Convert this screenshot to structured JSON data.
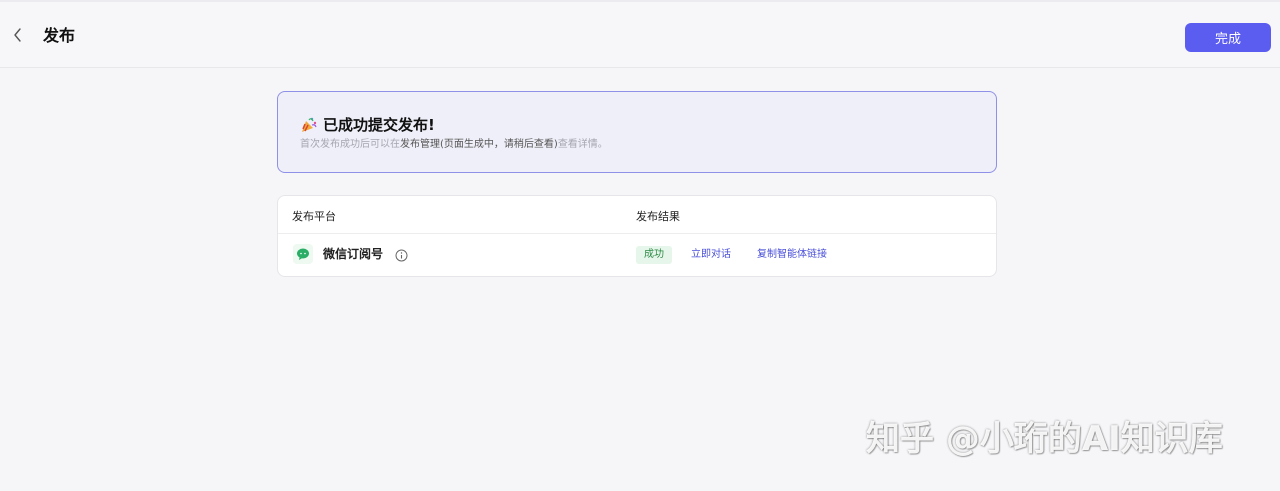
{
  "header": {
    "title": "发布",
    "done_label": "完成",
    "back_icon": "chevron-left-icon"
  },
  "notice": {
    "icon": "party-popper-icon",
    "title": "已成功提交发布!",
    "subtitle_prefix": "首次发布成功后可以在",
    "subtitle_link": "发布管理(页面生成中，请稍后查看)",
    "subtitle_suffix": "查看详情。"
  },
  "table": {
    "headers": {
      "platform": "发布平台",
      "result": "发布结果"
    },
    "rows": [
      {
        "platform_icon": "wechat-icon",
        "platform": "微信订阅号",
        "status": "成功",
        "action_chat": "立即对话",
        "action_copy": "复制智能体链接"
      }
    ]
  },
  "watermark": "知乎 @小珩的AI知识库",
  "colors": {
    "primary": "#5b5cf0",
    "link": "#4a4fd8",
    "success_bg": "#e6f6ea",
    "success_text": "#2f8a47",
    "wechat_green": "#2aae67"
  }
}
